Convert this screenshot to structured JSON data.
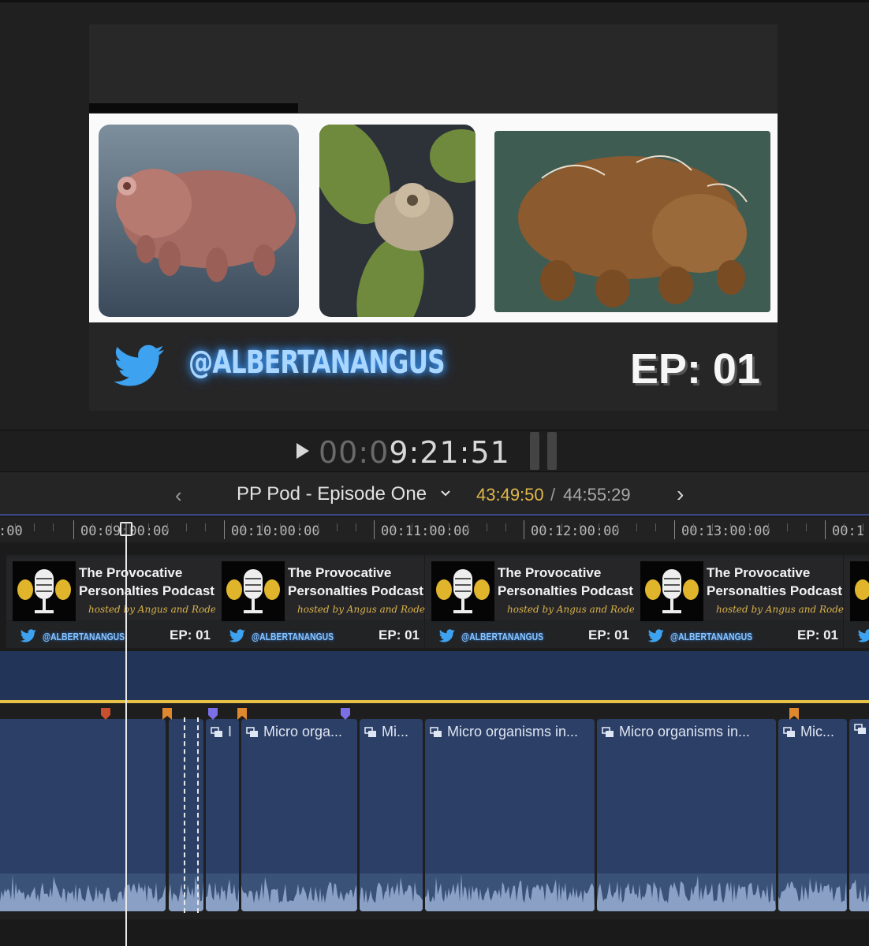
{
  "viewer": {
    "overlay_handle": "@ALBERTANANGUS",
    "overlay_episode": "EP: 01"
  },
  "transport": {
    "timecode_dim": "00:0",
    "timecode_lit": "9:21:51"
  },
  "timeline_header": {
    "project_name": "PP Pod - Episode One",
    "current_duration": "43:49:50",
    "separator": "/",
    "total_duration": "44:55:29"
  },
  "ruler": {
    "labels": [
      ":00",
      "00:09:00:00",
      "00:10:00:00",
      "00:11:00:00",
      "00:12:00:00",
      "00:13:00:00",
      "00:1"
    ]
  },
  "video_clip": {
    "title_line1": "The Provocative",
    "title_line2": "Personalties Podcast",
    "hosted_by": "hosted by Angus and Rodeen",
    "handle": "@ALBERTANANGUS",
    "episode": "EP: 01"
  },
  "audio_clips": [
    {
      "label": ""
    },
    {
      "label": ""
    },
    {
      "label": "I"
    },
    {
      "label": "Micro orga..."
    },
    {
      "label": "Mi..."
    },
    {
      "label": "Micro organisms in..."
    },
    {
      "label": "Micro organisms in..."
    },
    {
      "label": "Mic..."
    },
    {
      "label": ""
    }
  ],
  "colors": {
    "accent_blue": "#3a4a86",
    "duration_yellow": "#e0b84a",
    "marker_orange": "#e0882e",
    "marker_red": "#c9502e",
    "marker_purple": "#7a6fe6",
    "audio_clip": "#2c3f66"
  }
}
